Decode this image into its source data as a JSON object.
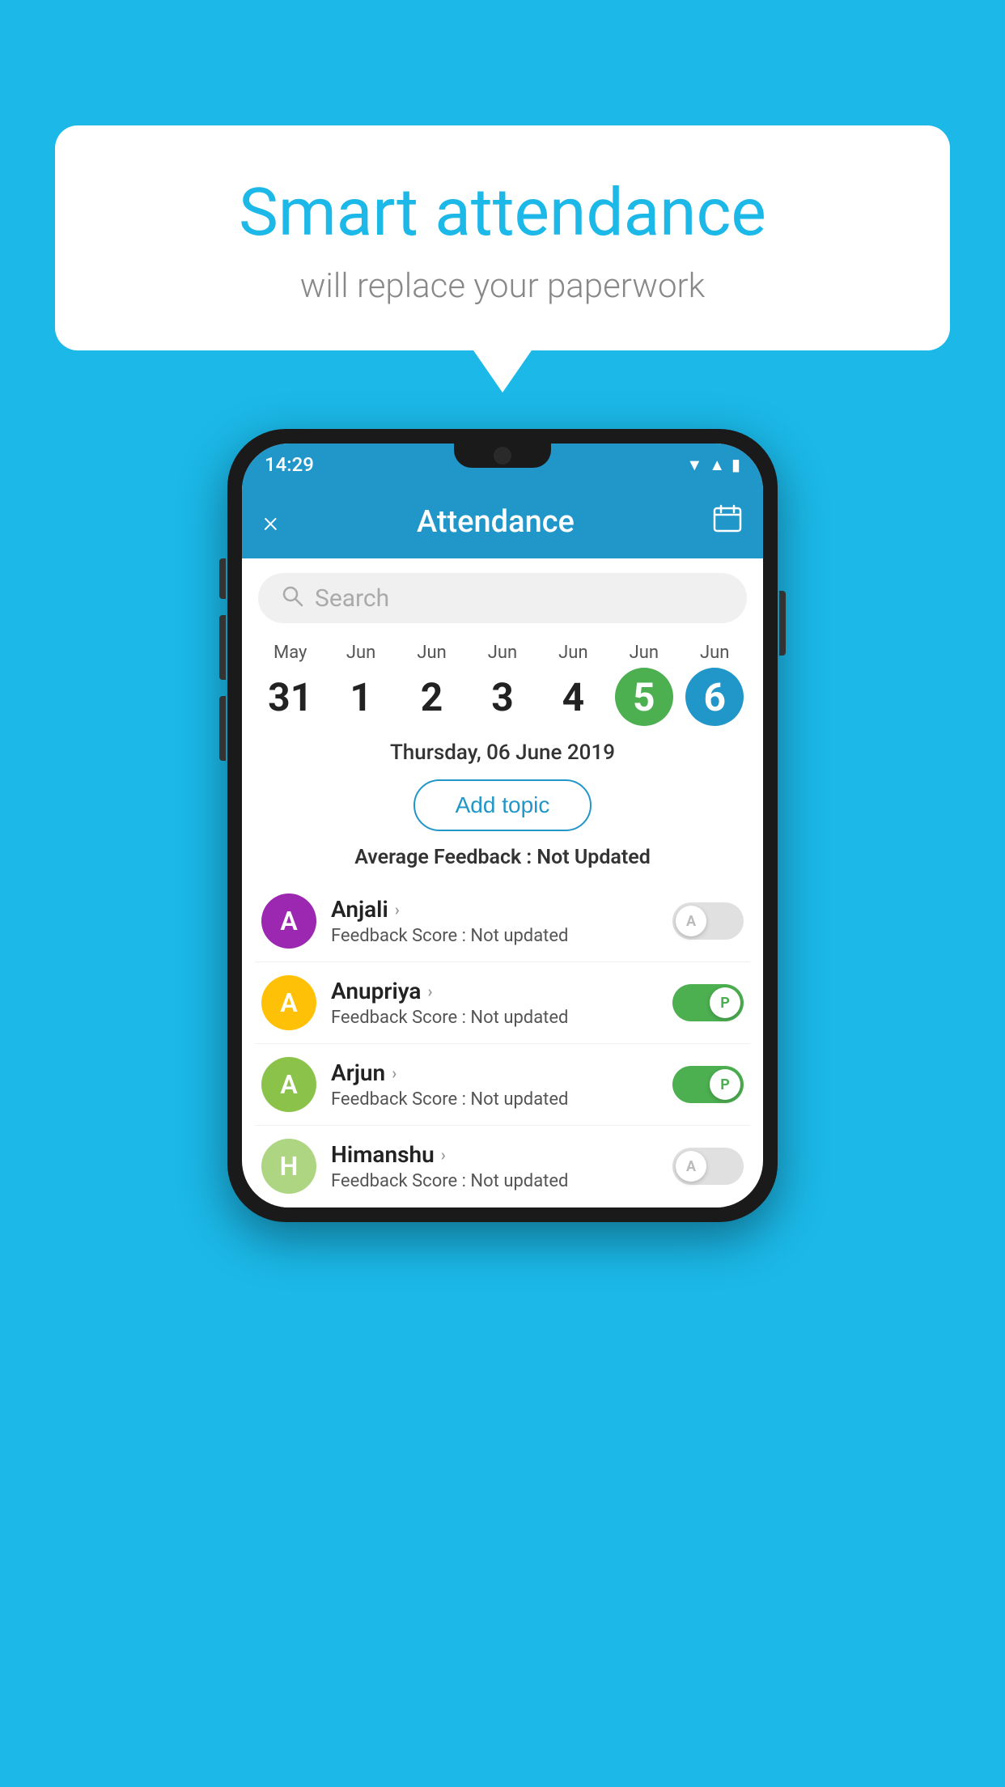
{
  "background": {
    "color": "#1BB8E8"
  },
  "speech_bubble": {
    "title": "Smart attendance",
    "subtitle": "will replace your paperwork"
  },
  "phone": {
    "status_bar": {
      "time": "14:29",
      "icons": [
        "wifi",
        "signal",
        "battery"
      ]
    },
    "header": {
      "close_label": "×",
      "title": "Attendance",
      "calendar_icon": "📅"
    },
    "search": {
      "placeholder": "Search"
    },
    "calendar": {
      "dates": [
        {
          "month": "May",
          "day": "31",
          "state": "normal"
        },
        {
          "month": "Jun",
          "day": "1",
          "state": "normal"
        },
        {
          "month": "Jun",
          "day": "2",
          "state": "normal"
        },
        {
          "month": "Jun",
          "day": "3",
          "state": "normal"
        },
        {
          "month": "Jun",
          "day": "4",
          "state": "normal"
        },
        {
          "month": "Jun",
          "day": "5",
          "state": "today"
        },
        {
          "month": "Jun",
          "day": "6",
          "state": "selected"
        }
      ]
    },
    "selected_date_label": "Thursday, 06 June 2019",
    "add_topic_label": "Add topic",
    "avg_feedback_label": "Average Feedback :",
    "avg_feedback_value": "Not Updated",
    "students": [
      {
        "name": "Anjali",
        "initial": "A",
        "avatar_color": "#9C27B0",
        "feedback_label": "Feedback Score :",
        "feedback_value": "Not updated",
        "attendance": "absent",
        "toggle_letter": "A"
      },
      {
        "name": "Anupriya",
        "initial": "A",
        "avatar_color": "#FFC107",
        "feedback_label": "Feedback Score :",
        "feedback_value": "Not updated",
        "attendance": "present",
        "toggle_letter": "P"
      },
      {
        "name": "Arjun",
        "initial": "A",
        "avatar_color": "#8BC34A",
        "feedback_label": "Feedback Score :",
        "feedback_value": "Not updated",
        "attendance": "present",
        "toggle_letter": "P"
      },
      {
        "name": "Himanshu",
        "initial": "H",
        "avatar_color": "#AED581",
        "feedback_label": "Feedback Score :",
        "feedback_value": "Not updated",
        "attendance": "absent",
        "toggle_letter": "A"
      }
    ]
  }
}
